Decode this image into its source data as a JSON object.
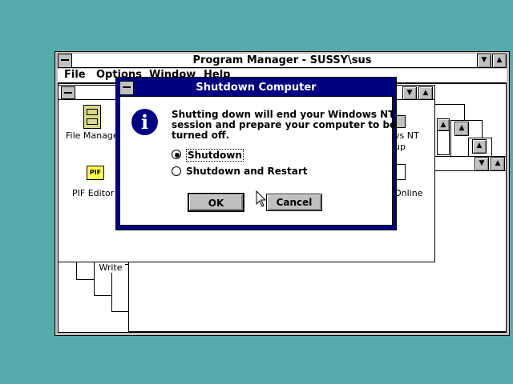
{
  "program_manager": {
    "title": "Program Manager - SUSSY\\sus",
    "menu": [
      "File",
      "Options",
      "Window",
      "Help"
    ]
  },
  "group_window": {
    "icons": [
      {
        "label": "File Manage",
        "icon": "file-cabinet-icon"
      },
      {
        "label": "PIF Editor",
        "icon": "pif-editor-icon"
      }
    ],
    "right_labels": [
      "vs NT",
      "up",
      "Online"
    ]
  },
  "back_window": {
    "icon_label": "Write"
  },
  "dialog": {
    "title": "Shutdown Computer",
    "message_lines": [
      "Shutting down will end your Windows NT",
      "session and prepare your computer to be",
      "turned off."
    ],
    "options": [
      {
        "label": "Shutdown",
        "selected": true
      },
      {
        "label": "Shutdown and Restart",
        "selected": false
      }
    ],
    "ok_label": "OK",
    "cancel_label": "Cancel",
    "icon": "info-icon"
  },
  "colors": {
    "desktop": "#55AAAA",
    "active_title": "#000080",
    "button_face": "#C0C0C0"
  }
}
